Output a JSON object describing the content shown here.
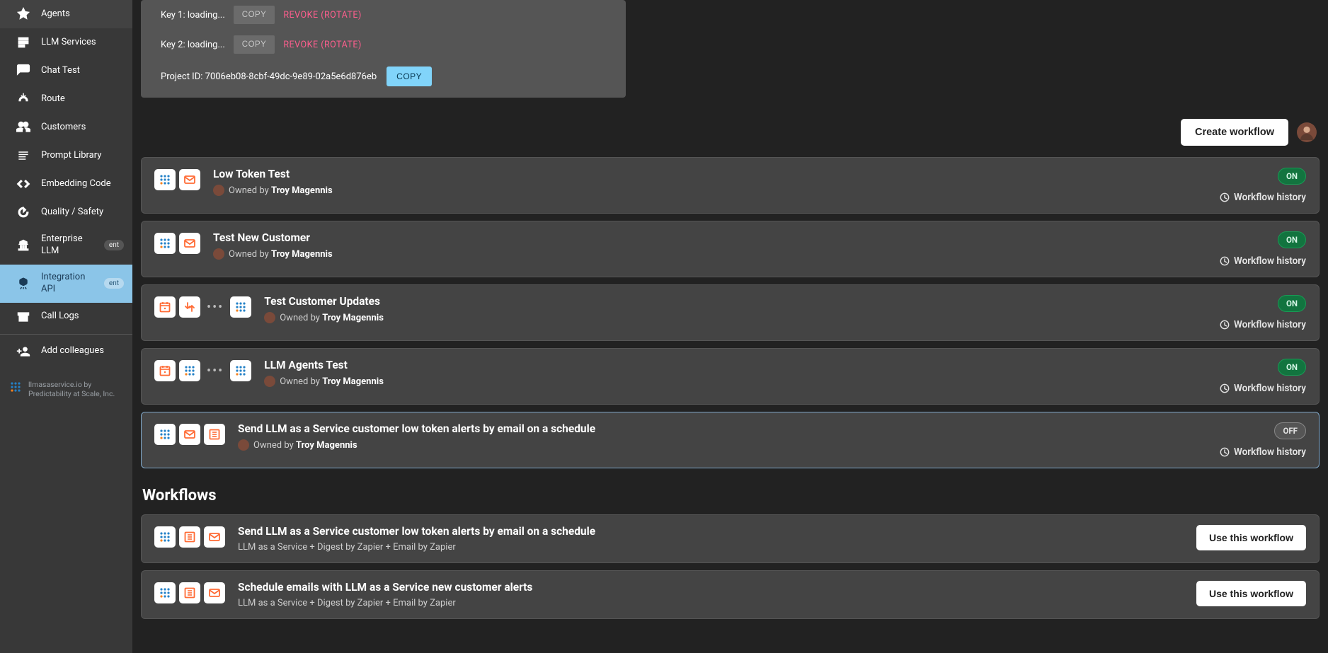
{
  "sidebar": {
    "items": [
      {
        "label": "Agents",
        "badge": null,
        "active": false
      },
      {
        "label": "LLM Services",
        "badge": null,
        "active": false
      },
      {
        "label": "Chat Test",
        "badge": null,
        "active": false
      },
      {
        "label": "Route",
        "badge": null,
        "active": false
      },
      {
        "label": "Customers",
        "badge": null,
        "active": false
      },
      {
        "label": "Prompt Library",
        "badge": null,
        "active": false
      },
      {
        "label": "Embedding Code",
        "badge": null,
        "active": false
      },
      {
        "label": "Quality / Safety",
        "badge": null,
        "active": false
      },
      {
        "label": "Enterprise LLM",
        "badge": "ent",
        "active": false
      },
      {
        "label": "Integration API",
        "badge": "ent",
        "active": true
      },
      {
        "label": "Call Logs",
        "badge": null,
        "active": false
      }
    ],
    "add_colleagues": "Add colleagues",
    "footer": "llmasaservice.io by Predictability at Scale, Inc."
  },
  "keys": {
    "key1_label": "Key 1: loading...",
    "key2_label": "Key 2: loading...",
    "copy": "COPY",
    "revoke": "REVOKE (ROTATE)",
    "project_label": "Project ID:",
    "project_id": "7006eb08-8cbf-49dc-9e89-02a5e6d876eb",
    "project_copy": "COPY"
  },
  "toolbar": {
    "create": "Create workflow"
  },
  "owned_prefix": "Owned by ",
  "owner_name": "Troy Magennis",
  "history_label": "Workflow history",
  "status": {
    "on": "ON",
    "off": "OFF"
  },
  "zaps": [
    {
      "title": "Low Token Test",
      "icons": [
        "dots",
        "mail"
      ],
      "on": true,
      "selected": false
    },
    {
      "title": "Test New Customer",
      "icons": [
        "dots",
        "mail"
      ],
      "on": true,
      "selected": false
    },
    {
      "title": "Test Customer Updates",
      "icons": [
        "cal",
        "arrowdn",
        "more",
        "dots"
      ],
      "on": true,
      "selected": false
    },
    {
      "title": "LLM Agents Test",
      "icons": [
        "cal",
        "dots",
        "more",
        "dots"
      ],
      "on": true,
      "selected": false
    },
    {
      "title": "Send LLM as a Service customer low token alerts by email on a schedule",
      "icons": [
        "dots",
        "mail",
        "digest"
      ],
      "on": false,
      "selected": true
    }
  ],
  "section_workflows": "Workflows",
  "workflow_templates": [
    {
      "title": "Send LLM as a Service customer low token alerts by email on a schedule",
      "sub": "LLM as a Service + Digest by Zapier + Email by Zapier",
      "icons": [
        "dots",
        "digest",
        "mail"
      ]
    },
    {
      "title": "Schedule emails with LLM as a Service new customer alerts",
      "sub": "LLM as a Service + Digest by Zapier + Email by Zapier",
      "icons": [
        "dots",
        "digest",
        "mail"
      ]
    }
  ],
  "use_workflow": "Use this workflow"
}
